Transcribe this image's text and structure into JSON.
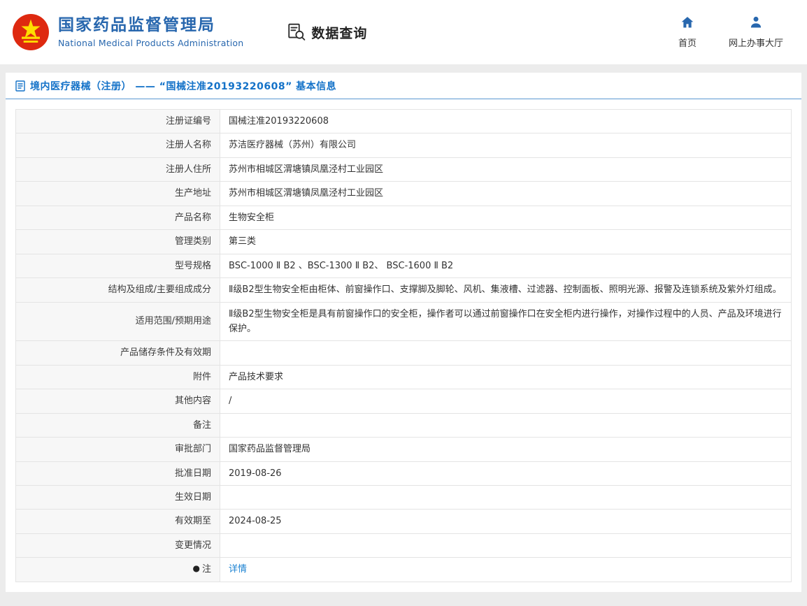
{
  "header": {
    "org_name_cn": "国家药品监督管理局",
    "org_name_en": "National Medical Products Administration",
    "data_query_label": "数据查询",
    "nav_home_label": "首页",
    "nav_hall_label": "网上办事大厅"
  },
  "page": {
    "title": "境内医疗器械（注册） —— “国械注准20193220608” 基本信息"
  },
  "colors": {
    "brand_blue": "#2867ae",
    "title_blue": "#1472c8",
    "link_blue": "#1b82d2",
    "emblem_red": "#de2910",
    "emblem_yellow": "#ffde00",
    "page_bg": "#ececec",
    "label_cell_bg": "#f7f7f7"
  },
  "table": {
    "rows": [
      {
        "label": "注册证编号",
        "value": "国械注准20193220608"
      },
      {
        "label": "注册人名称",
        "value": "苏洁医疗器械（苏州）有限公司"
      },
      {
        "label": "注册人住所",
        "value": "苏州市相城区渭塘镇凤凰泾村工业园区"
      },
      {
        "label": "生产地址",
        "value": "苏州市相城区渭塘镇凤凰泾村工业园区"
      },
      {
        "label": "产品名称",
        "value": "生物安全柜"
      },
      {
        "label": "管理类别",
        "value": "第三类"
      },
      {
        "label": "型号规格",
        "value": "BSC-1000 Ⅱ B2 、BSC-1300 Ⅱ B2、 BSC-1600 Ⅱ B2"
      },
      {
        "label": "结构及组成/主要组成成分",
        "value": "Ⅱ级B2型生物安全柜由柜体、前窗操作口、支撑脚及脚轮、风机、集液槽、过滤器、控制面板、照明光源、报警及连锁系统及紫外灯组成。"
      },
      {
        "label": "适用范围/预期用途",
        "value": "Ⅱ级B2型生物安全柜是具有前窗操作口的安全柜，操作者可以通过前窗操作口在安全柜内进行操作，对操作过程中的人员、产品及环境进行保护。"
      },
      {
        "label": "产品储存条件及有效期",
        "value": ""
      },
      {
        "label": "附件",
        "value": "产品技术要求"
      },
      {
        "label": "其他内容",
        "value": "/"
      },
      {
        "label": "备注",
        "value": ""
      },
      {
        "label": "审批部门",
        "value": "国家药品监督管理局"
      },
      {
        "label": "批准日期",
        "value": "2019-08-26"
      },
      {
        "label": "生效日期",
        "value": ""
      },
      {
        "label": "有效期至",
        "value": "2024-08-25"
      },
      {
        "label": "变更情况",
        "value": ""
      },
      {
        "label": "注",
        "icon": "note-icon",
        "value": "详情",
        "link": true
      }
    ]
  }
}
